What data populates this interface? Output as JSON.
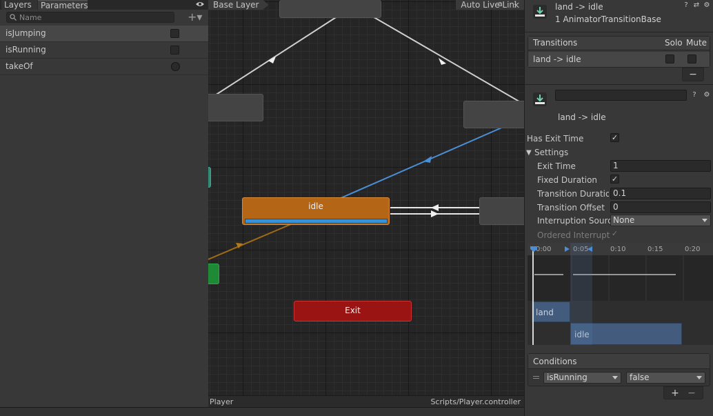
{
  "left_panel": {
    "tabs": [
      "Layers",
      "Parameters"
    ],
    "search_placeholder": "Name",
    "add_label": "+▾",
    "parameters": [
      {
        "name": "isJumping",
        "kind": "bool"
      },
      {
        "name": "isRunning",
        "kind": "bool"
      },
      {
        "name": "takeOf",
        "kind": "trigger"
      }
    ]
  },
  "graph": {
    "breadcrumb": "Base Layer",
    "live_link": "Auto Live Link",
    "states": {
      "idle": "idle",
      "exit": "Exit"
    },
    "footer_left": "Player",
    "footer_right": "Scripts/Player.controller"
  },
  "inspector": {
    "header_title": "land -> idle",
    "header_subtitle": "1 AnimatorTransitionBase",
    "transitions": {
      "header": "Transitions",
      "solo_label": "Solo",
      "mute_label": "Mute",
      "rows": [
        "land -> idle"
      ],
      "remove_label": "−"
    },
    "transition_title": "land -> idle",
    "has_exit_time_label": "Has Exit Time",
    "settings_label": "Settings",
    "props": {
      "exit_time": {
        "label": "Exit Time",
        "value": "1"
      },
      "fixed_duration": {
        "label": "Fixed Duration"
      },
      "transition_duration": {
        "label": "Transition Duration",
        "value": "0.1"
      },
      "transition_offset": {
        "label": "Transition Offset",
        "value": "0"
      },
      "interruption_source": {
        "label": "Interruption Source",
        "value": "None"
      },
      "ordered_interruption": {
        "label": "Ordered Interruption"
      }
    },
    "timeline": {
      "ticks": [
        "0:00",
        "0:05",
        "0:10",
        "0:15",
        "0:20"
      ],
      "track_from": "land",
      "track_to": "idle"
    },
    "conditions": {
      "header": "Conditions",
      "parameter": "isRunning",
      "value": "false",
      "add_label": "+",
      "remove_label": "−"
    }
  },
  "colors": {
    "idle_state": "#b56516",
    "exit_state": "#9a1414",
    "progress": "#3792d8",
    "transition_blue": "#4a8fd6"
  }
}
